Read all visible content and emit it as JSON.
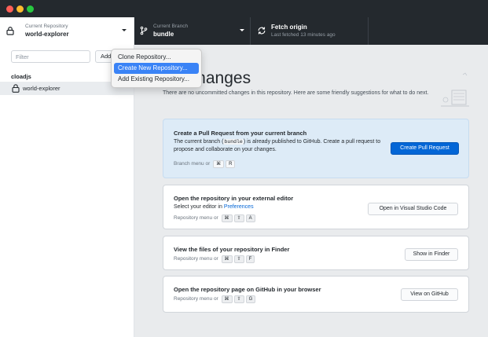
{
  "window": {
    "traffic_lights": {
      "close": "#ff5f57",
      "minimize": "#febc2e",
      "zoom": "#28c840"
    }
  },
  "toolbar": {
    "repository": {
      "label": "Current Repository",
      "value": "world-explorer",
      "icon": "repo-lock-icon"
    },
    "branch": {
      "label": "Current Branch",
      "value": "bundle",
      "icon": "git-branch-icon"
    },
    "fetch": {
      "label": "Fetch origin",
      "status": "Last fetched 13 minutes ago",
      "icon": "sync-icon"
    }
  },
  "sidebar": {
    "filter_placeholder": "Filter",
    "add_label": "Add",
    "groups": [
      {
        "name": "cloadjs",
        "items": [
          {
            "label": "world-explorer",
            "icon": "repo-lock-icon",
            "selected": true
          }
        ]
      }
    ]
  },
  "menu": {
    "items": [
      {
        "label": "Clone Repository..."
      },
      {
        "label": "Create New Repository...",
        "selected": true
      },
      {
        "label": "Add Existing Repository..."
      }
    ]
  },
  "main": {
    "heading": "cal changes",
    "intro": "There are no uncommitted changes in this repository. Here are some friendly suggestions for what to do next.",
    "cards": [
      {
        "title": "Create a Pull Request from your current branch",
        "desc_before": "The current branch (",
        "desc_code": "bundle",
        "desc_after": ") is already published to GitHub. Create a pull request to propose and collaborate on your changes.",
        "shortcut_prefix": "Branch menu or",
        "keys": [
          "⌘",
          "R"
        ],
        "button": "Create Pull Request"
      },
      {
        "title": "Open the repository in your external editor",
        "desc_before": "Select your editor in",
        "desc_link": "Preferences",
        "shortcut_prefix": "Repository menu or",
        "keys": [
          "⌘",
          "⇧",
          "A"
        ],
        "button": "Open in Visual Studio Code"
      },
      {
        "title": "View the files of your repository in Finder",
        "shortcut_prefix": "Repository menu or",
        "keys": [
          "⌘",
          "⇧",
          "F"
        ],
        "button": "Show in Finder"
      },
      {
        "title": "Open the repository page on GitHub in your browser",
        "shortcut_prefix": "Repository menu or",
        "keys": [
          "⌘",
          "⇧",
          "G"
        ],
        "button": "View on GitHub"
      }
    ]
  },
  "colors": {
    "toolbar_bg": "#24292e",
    "accent": "#0366d6",
    "menu_selection": "#3a83f6",
    "main_bg": "#e9ebed",
    "highlight_card_bg": "#ddebf7"
  }
}
